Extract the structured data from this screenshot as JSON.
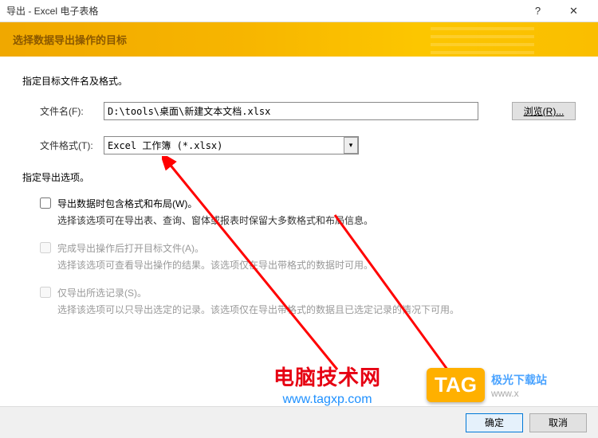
{
  "window": {
    "title": "导出 - Excel 电子表格",
    "help_icon": "?",
    "close_icon": "✕"
  },
  "banner": {
    "text": "选择数据导出操作的目标"
  },
  "section1": {
    "title": "指定目标文件名及格式。",
    "filename_label": "文件名(F):",
    "filename_value": "D:\\tools\\桌面\\新建文本文档.xlsx",
    "browse_label": "浏览(R)...",
    "format_label": "文件格式(T):",
    "format_value": "Excel 工作簿 (*.xlsx)"
  },
  "section2": {
    "title": "指定导出选项。",
    "opt1": {
      "label": "导出数据时包含格式和布局(W)。",
      "desc": "选择该选项可在导出表、查询、窗体或报表时保留大多数格式和布局信息。"
    },
    "opt2": {
      "label": "完成导出操作后打开目标文件(A)。",
      "desc": "选择该选项可查看导出操作的结果。该选项仅在导出带格式的数据时可用。"
    },
    "opt3": {
      "label": "仅导出所选记录(S)。",
      "desc": "选择该选项可以只导出选定的记录。该选项仅在导出带格式的数据且已选定记录的情况下可用。"
    }
  },
  "footer": {
    "ok": "确定",
    "cancel": "取消"
  },
  "watermark1": {
    "line1": "电脑技术网",
    "line2": "www.tagxp.com"
  },
  "watermark2": {
    "tag": "TAG",
    "line1": "极光下载站",
    "line2": "www.x"
  }
}
